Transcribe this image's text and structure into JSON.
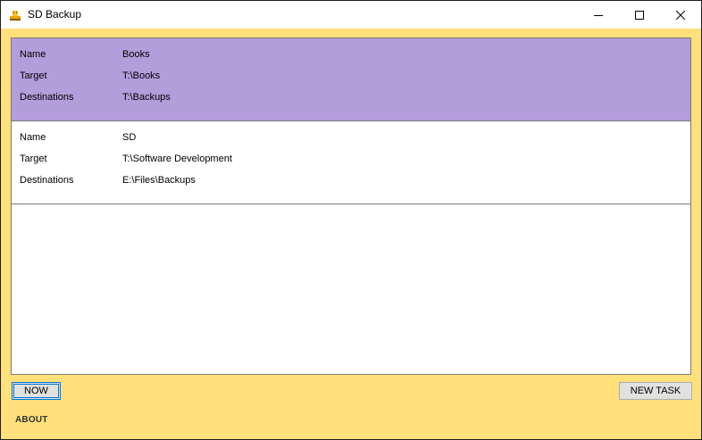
{
  "window": {
    "title": "SD Backup",
    "icon": "usb-drive-icon"
  },
  "titlebar_buttons": [
    "minimize-icon",
    "maximize-icon",
    "close-icon"
  ],
  "tasks": [
    {
      "selected": true,
      "name_label": "Name",
      "name": "Books",
      "target_label": "Target",
      "target": "T:\\Books",
      "destinations_label": "Destinations",
      "destinations": "T:\\Backups"
    },
    {
      "selected": false,
      "name_label": "Name",
      "name": "SD",
      "target_label": "Target",
      "target": "T:\\Software Development",
      "destinations_label": "Destinations",
      "destinations": "E:\\Files\\Backups"
    }
  ],
  "buttons": {
    "now": "NOW",
    "new_task": "NEW TASK",
    "about": "ABOUT"
  },
  "colors": {
    "background": "#ffe07a",
    "selected_row": "#b39ddb"
  }
}
